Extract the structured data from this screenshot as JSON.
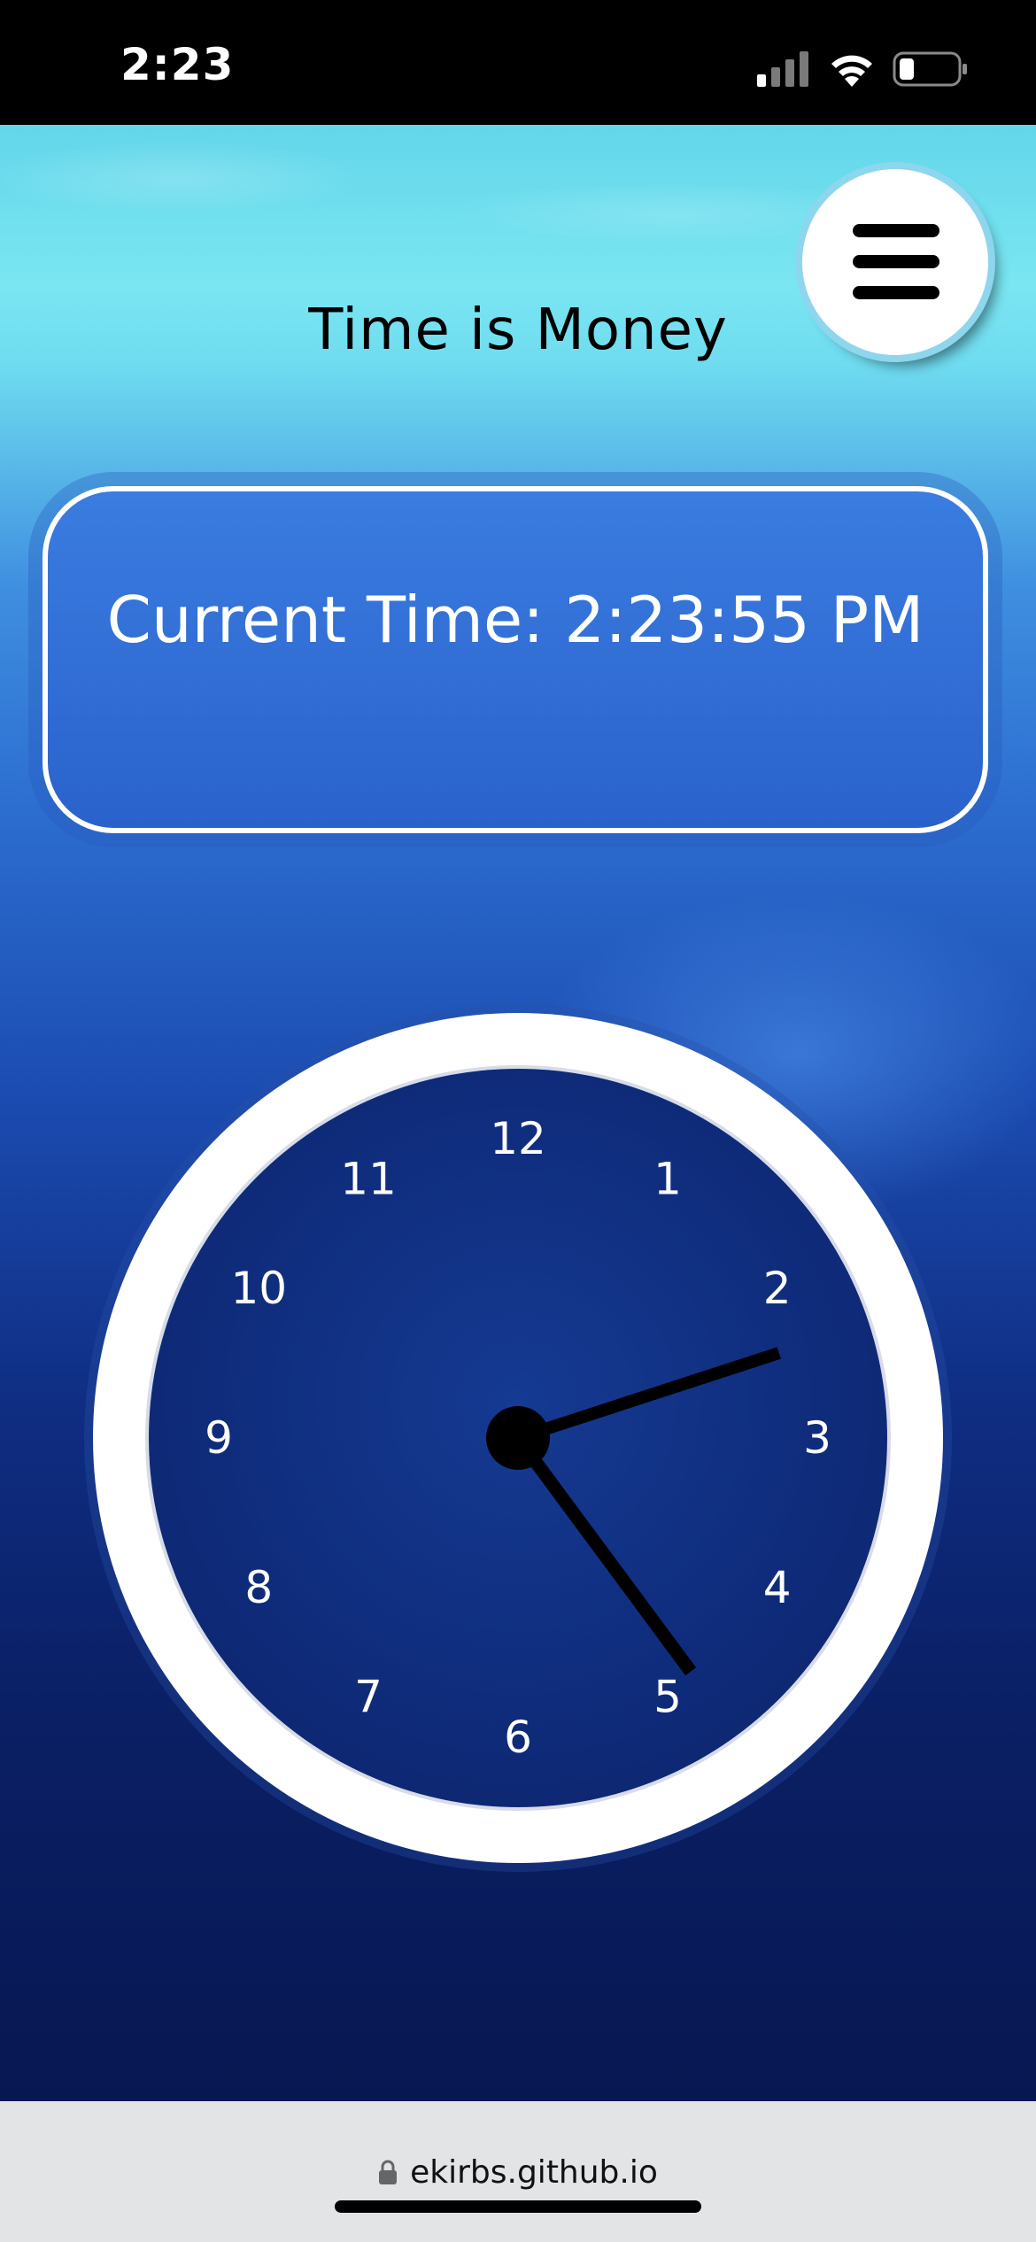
{
  "status_bar": {
    "time": "2:23"
  },
  "page": {
    "title": "Time is Money",
    "current_time_text": "Current Time: 2:23:55 PM"
  },
  "clock": {
    "numbers": [
      "12",
      "1",
      "2",
      "3",
      "4",
      "5",
      "6",
      "7",
      "8",
      "9",
      "10",
      "11"
    ],
    "hours": 2,
    "minutes": 23,
    "seconds": 55
  },
  "browser": {
    "url": "ekirbs.github.io"
  },
  "colors": {
    "title": "#000000",
    "card_border": "#ffffff",
    "clock_face": "#0f2c7c",
    "clock_rim": "#ffffff",
    "hands": "#000000"
  }
}
